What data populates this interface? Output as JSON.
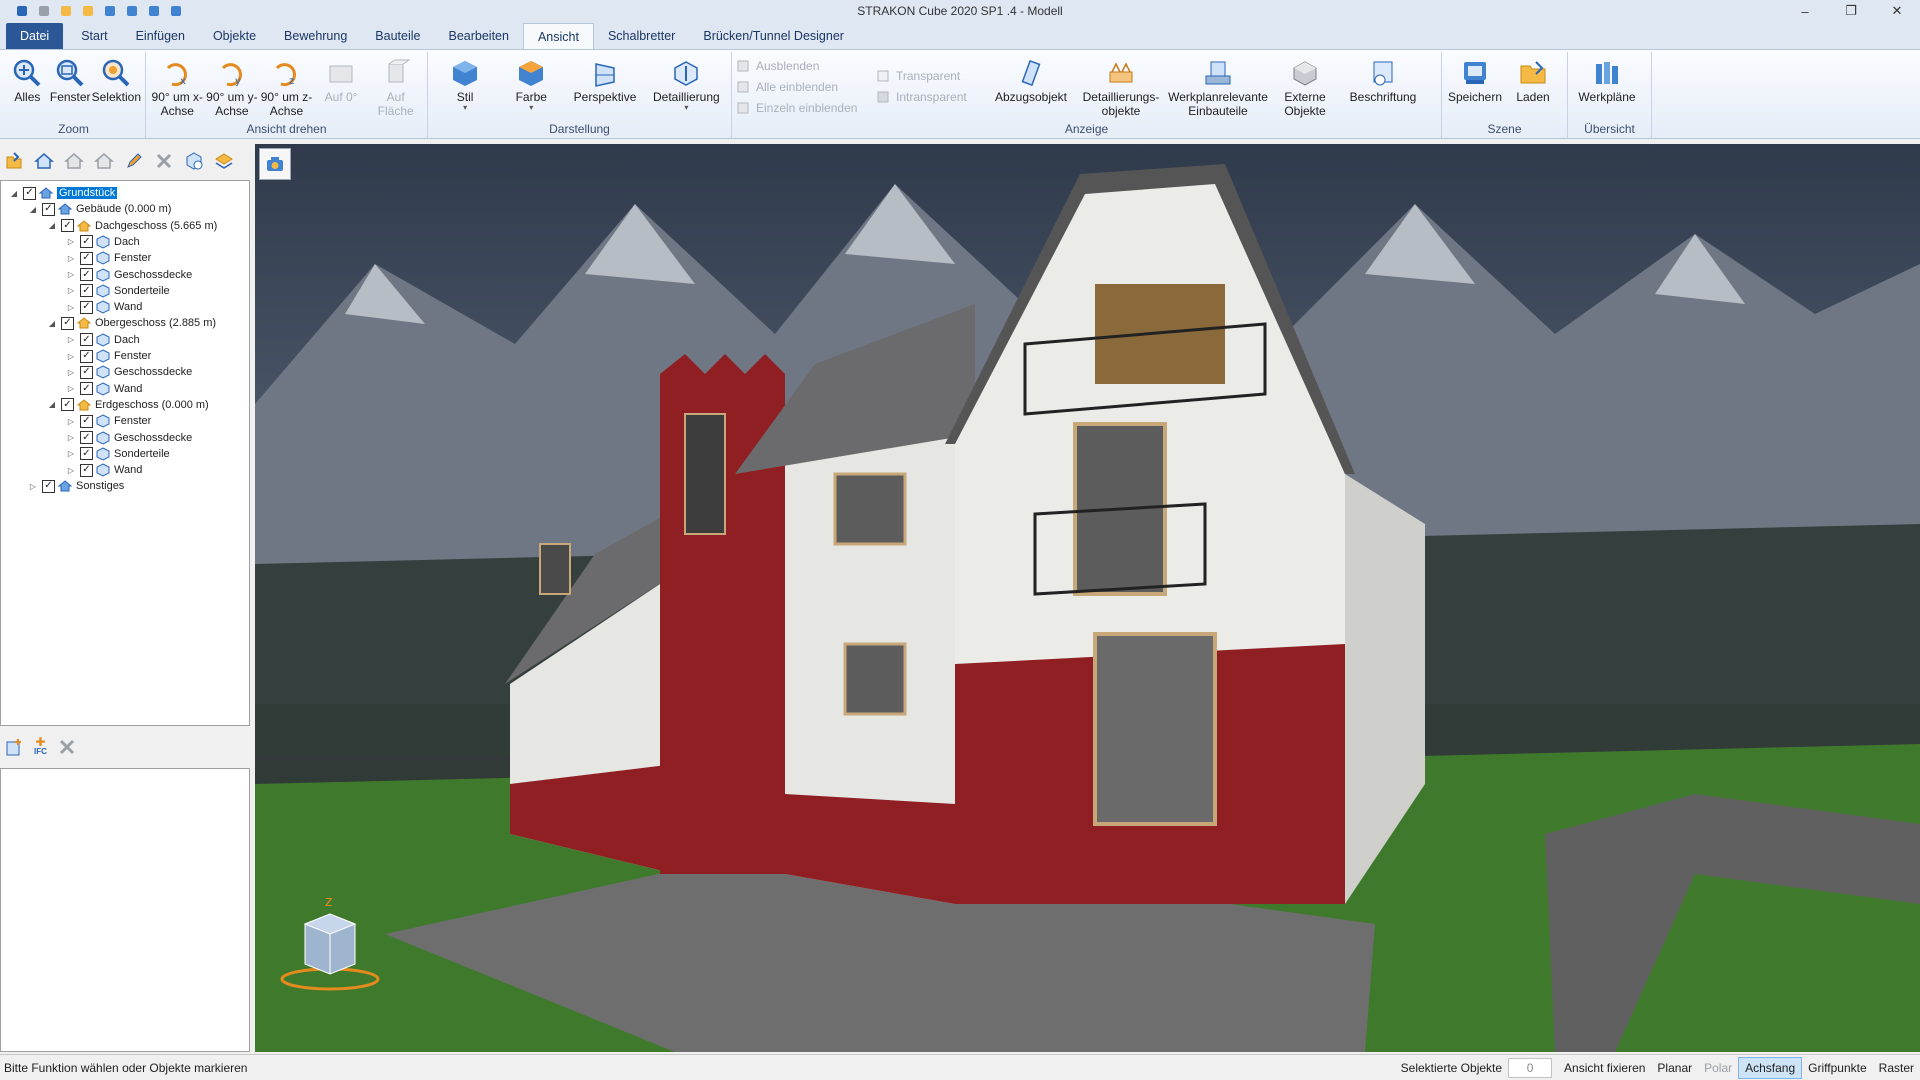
{
  "window": {
    "title": "STRAKON Cube 2020 SP1 .4 - Modell",
    "controls": [
      "–",
      "❐",
      "✕"
    ]
  },
  "qat": [
    "undo-icon",
    "redo-icon",
    "new-icon",
    "open-icon",
    "copy-icon",
    "save-icon",
    "print-icon",
    "sync-icon"
  ],
  "tabs": {
    "file": "Datei",
    "items": [
      "Start",
      "Einfügen",
      "Objekte",
      "Bewehrung",
      "Bauteile",
      "Bearbeiten",
      "Ansicht",
      "Schalbretter",
      "Brücken/Tunnel Designer"
    ],
    "active": "Ansicht"
  },
  "ribbon": {
    "zoom": {
      "label": "Zoom",
      "buttons": [
        "Alles",
        "Fenster",
        "Selektion"
      ]
    },
    "rotate": {
      "label": "Ansicht drehen",
      "buttons": [
        "90° um x-Achse",
        "90° um y-Achse",
        "90° um z-Achse",
        "Auf 0°",
        "Auf Fläche"
      ]
    },
    "display": {
      "label": "Darstellung",
      "buttons": [
        "Stil",
        "Farbe",
        "Perspektive",
        "Detaillierung"
      ]
    },
    "show": {
      "label": "Anzeige",
      "small1": [
        "Ausblenden",
        "Alle einblenden",
        "Einzeln einblenden"
      ],
      "small2": [
        "Transparent",
        "Intransparent"
      ],
      "buttons": [
        "Abzugsobjekt",
        "Detaillierungs-objekte",
        "Werkplanrelevante Einbauteile",
        "Externe Objekte",
        "Beschriftung"
      ]
    },
    "scene": {
      "label": "Szene",
      "buttons": [
        "Speichern",
        "Laden"
      ]
    },
    "overview": {
      "label": "Übersicht",
      "buttons": [
        "Werkpläne"
      ]
    }
  },
  "tree": {
    "nodes": [
      {
        "label": "Grundstück",
        "level": 0,
        "expanded": true,
        "selected": true
      },
      {
        "label": "Gebäude (0.000 m)",
        "level": 1,
        "expanded": true
      },
      {
        "label": "Dachgeschoss (5.665 m)",
        "level": 2,
        "expanded": true
      },
      {
        "label": "Dach",
        "level": 3
      },
      {
        "label": "Fenster",
        "level": 3
      },
      {
        "label": "Geschossdecke",
        "level": 3
      },
      {
        "label": "Sonderteile",
        "level": 3
      },
      {
        "label": "Wand",
        "level": 3
      },
      {
        "label": "Obergeschoss (2.885 m)",
        "level": 2,
        "expanded": true
      },
      {
        "label": "Dach",
        "level": 3
      },
      {
        "label": "Fenster",
        "level": 3
      },
      {
        "label": "Geschossdecke",
        "level": 3
      },
      {
        "label": "Wand",
        "level": 3
      },
      {
        "label": "Erdgeschoss (0.000 m)",
        "level": 2,
        "expanded": true
      },
      {
        "label": "Fenster",
        "level": 3
      },
      {
        "label": "Geschossdecke",
        "level": 3
      },
      {
        "label": "Sonderteile",
        "level": 3
      },
      {
        "label": "Wand",
        "level": 3
      },
      {
        "label": "Sonstiges",
        "level": 1
      }
    ]
  },
  "prop_toolbar": {
    "ifc_label": "IFC"
  },
  "statusbar": {
    "message": "Bitte Funktion wählen oder Objekte markieren",
    "selected_label": "Selektierte Objekte",
    "selected_count": "0",
    "items": [
      {
        "label": "Ansicht fixieren",
        "state": "normal"
      },
      {
        "label": "Planar",
        "state": "normal"
      },
      {
        "label": "Polar",
        "state": "off"
      },
      {
        "label": "Achsfang",
        "state": "on"
      },
      {
        "label": "Griffpunkte",
        "state": "normal"
      },
      {
        "label": "Raster",
        "state": "normal"
      }
    ]
  },
  "colors": {
    "accent": "#2b5797",
    "wall_red": "#8f1f22",
    "wall_white": "#e9e9e6",
    "roof": "#6b6b6d",
    "grass": "#3f7a2c"
  }
}
